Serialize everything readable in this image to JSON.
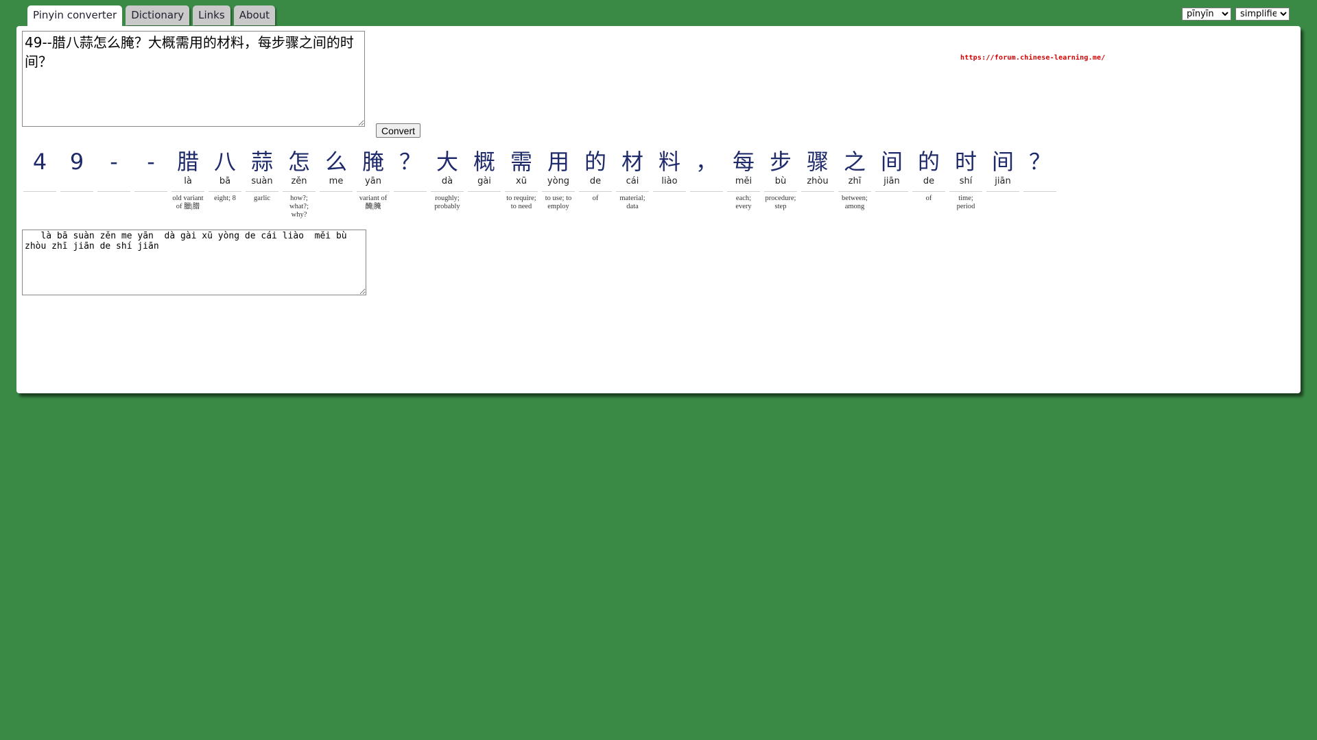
{
  "tabs": [
    {
      "label": "Pinyin converter",
      "active": true
    },
    {
      "label": "Dictionary",
      "active": false
    },
    {
      "label": "Links",
      "active": false
    },
    {
      "label": "About",
      "active": false
    }
  ],
  "selects": {
    "mode": {
      "value": "pīnyīn",
      "options": [
        "pīnyīn"
      ]
    },
    "script": {
      "value": "simplified",
      "options": [
        "simplified"
      ]
    }
  },
  "input": {
    "text": "49--腊八蒜怎么腌？大概需用的材料，每步骤之间的时间？"
  },
  "convert_label": "Convert",
  "watermark_url": "https://forum.chinese-learning.me/",
  "segments": [
    {
      "chars": "4",
      "pinyin": "",
      "def": ""
    },
    {
      "chars": "9",
      "pinyin": "",
      "def": ""
    },
    {
      "chars": "-",
      "pinyin": "",
      "def": ""
    },
    {
      "chars": "-",
      "pinyin": "",
      "def": ""
    },
    {
      "chars": "腊",
      "pinyin": "là",
      "def": "old variant of 臘|腊"
    },
    {
      "chars": "八",
      "pinyin": "bā",
      "def": "eight; 8"
    },
    {
      "chars": "蒜",
      "pinyin": "suàn",
      "def": "garlic"
    },
    {
      "chars": "怎",
      "pinyin": "zěn",
      "def": "how?; what?; why?"
    },
    {
      "chars": "么",
      "pinyin": "me",
      "def": ""
    },
    {
      "chars": "腌",
      "pinyin": "yān",
      "def": "variant of 醃|腌"
    },
    {
      "chars": "？",
      "pinyin": "",
      "def": ""
    },
    {
      "chars": "大",
      "pinyin": "dà",
      "def": "roughly; probably"
    },
    {
      "chars": "概",
      "pinyin": "gài",
      "def": ""
    },
    {
      "chars": "需",
      "pinyin": "xū",
      "def": "to require; to need"
    },
    {
      "chars": "用",
      "pinyin": "yòng",
      "def": "to use; to employ"
    },
    {
      "chars": "的",
      "pinyin": "de",
      "def": "of"
    },
    {
      "chars": "材",
      "pinyin": "cái",
      "def": "material; data"
    },
    {
      "chars": "料",
      "pinyin": "liào",
      "def": ""
    },
    {
      "chars": "，",
      "pinyin": "",
      "def": ""
    },
    {
      "chars": "每",
      "pinyin": "měi",
      "def": "each; every"
    },
    {
      "chars": "步",
      "pinyin": "bù",
      "def": "procedure; step"
    },
    {
      "chars": "骤",
      "pinyin": "zhòu",
      "def": ""
    },
    {
      "chars": "之",
      "pinyin": "zhī",
      "def": "between; among"
    },
    {
      "chars": "间",
      "pinyin": "jiān",
      "def": ""
    },
    {
      "chars": "的",
      "pinyin": "de",
      "def": "of"
    },
    {
      "chars": "时",
      "pinyin": "shí",
      "def": "time; period"
    },
    {
      "chars": "间",
      "pinyin": "jiān",
      "def": ""
    },
    {
      "chars": "？",
      "pinyin": "",
      "def": ""
    }
  ],
  "output": {
    "text": "   là bā suàn zěn me yān  dà gài xū yòng de cái liào  měi bù zhòu zhī jiān de shí jiān"
  }
}
